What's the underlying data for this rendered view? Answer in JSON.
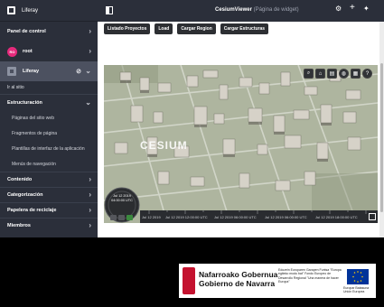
{
  "sidebar": {
    "product_name": "Liferay",
    "control_panel_label": "Panel de control",
    "user_initials": "RO",
    "user_name": "root",
    "site_name": "Liferay",
    "goto_site": "Ir al sitio",
    "structure_label": "Estructuración",
    "structure_items": [
      "Páginas del sitio web",
      "Fragmentos de página",
      "Plantillas de interfaz de la aplicación",
      "Menús de navegación"
    ],
    "sections": [
      "Contenido",
      "Categorización",
      "Papelera de reciclaje",
      "Miembros"
    ]
  },
  "header": {
    "title": "CesiumViewer",
    "subtitle": "(Página de widget)"
  },
  "toolbar_buttons": [
    "Listado Proyectos",
    "Load",
    "Cargar Region",
    "Cargar Estructuras"
  ],
  "viewer": {
    "watermark": "CESIUM",
    "clock_date": "Jul 12 2019",
    "clock_time": "04:00:00 UTC",
    "timeline_labels": [
      "Jul 12 2019",
      "Jul 12 2019 12:00:00 UTC",
      "Jul 12 2019 06:00:00 UTC",
      "Jul 12 2019 06:00:00 UTC",
      "Jul 12 2019 18:00:00 UTC",
      "Jul 12 2019 00:00:00 UTC"
    ],
    "tool_icons": [
      "search-icon",
      "home-icon",
      "layers-icon",
      "globe-icon",
      "imagery-icon",
      "help-icon"
    ]
  },
  "footer": {
    "gov_name_line1": "Nafarroako Gobernua",
    "gov_name_line2": "Gobierno de Navarra",
    "fund_text": "Edozein Europaren Garapen Funtsa \"Europa egiteko modu bat\" Fondo Europeo de Desarrollo Regional \"Una manera de hacer Europa\"",
    "eu_caption": "Europar Batasuna Unión Europea"
  },
  "colors": {
    "sidebar_bg": "#2b2f3a",
    "active_site_bg": "#4c5160",
    "avatar": "#e62a7c",
    "button_bg": "#2d2f33",
    "navarra_red": "#c4122f",
    "eu_blue": "#003399"
  }
}
